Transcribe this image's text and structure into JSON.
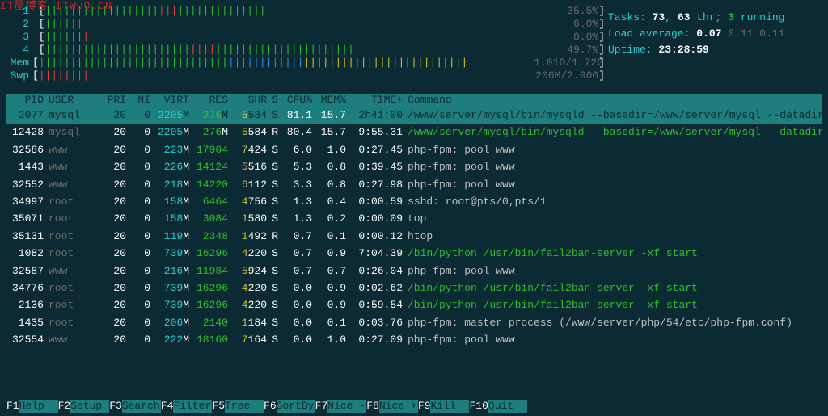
{
  "watermark": "IT屋博客  ITWUO.CN",
  "cpumeters": [
    {
      "label": "1",
      "seg": [
        {
          "c": "g",
          "n": 18
        },
        {
          "c": "r",
          "n": 3
        },
        {
          "c": "g",
          "n": 14
        }
      ],
      "pct": "35.5%"
    },
    {
      "label": "2",
      "seg": [
        {
          "c": "g",
          "n": 5
        },
        {
          "c": "r",
          "n": 1
        }
      ],
      "pct": "6.0%"
    },
    {
      "label": "3",
      "seg": [
        {
          "c": "g",
          "n": 6
        },
        {
          "c": "r",
          "n": 1
        }
      ],
      "pct": "8.0%"
    },
    {
      "label": "4",
      "seg": [
        {
          "c": "g",
          "n": 23
        },
        {
          "c": "r",
          "n": 4
        },
        {
          "c": "g",
          "n": 22
        }
      ],
      "pct": "49.7%"
    }
  ],
  "mem": {
    "label": "Mem",
    "seg": [
      {
        "c": "g",
        "n": 30
      },
      {
        "c": "bl",
        "n": 12
      },
      {
        "c": "y",
        "n": 26
      }
    ],
    "pct": "1.01G/1.72G"
  },
  "swp": {
    "label": "Swp",
    "seg": [
      {
        "c": "r",
        "n": 8
      }
    ],
    "pct": "206M/2.00G"
  },
  "info": {
    "tasks_label": "Tasks: ",
    "tasks": "73",
    "tasks_sep": ", ",
    "thr": "63",
    "thr_lbl": " thr; ",
    "running": "3",
    "running_lbl": " running",
    "la_label": "Load average: ",
    "la1": "0.07",
    "la2": " 0.11",
    "la3": " 0.11",
    "uptime_label": "Uptime: ",
    "uptime": "23:28:59"
  },
  "header": {
    "pid": "PID",
    "user": "USER",
    "pri": "PRI",
    "ni": "NI",
    "virt": "VIRT",
    "res": "RES",
    "shr": "SHR",
    "s": "S",
    "cpu": "CPU%",
    "mem": "MEM%",
    "time": "TIME+",
    "cmd": "Command"
  },
  "rows": [
    {
      "sel": true,
      "pid": "2077",
      "user": "mysql",
      "pri": "20",
      "ni": "0",
      "virt": "2205M",
      "res": "276M",
      "shr": "5584",
      "s": "S",
      "cpu": "81.1",
      "mem": "15.7",
      "time": "2h41:00",
      "cmd": "/www/server/mysql/bin/mysqld --basedir=/www/server/mysql --datadir"
    },
    {
      "pid": "12428",
      "user": "mysql",
      "pri": "20",
      "ni": "0",
      "virt": "2205M",
      "res": "276M",
      "shr": "5584",
      "s": "R",
      "cpu": "80.4",
      "mem": "15.7",
      "time": "9:55.31",
      "cmd": "/www/server/mysql/bin/mysqld --basedir=/www/server/mysql --datadir",
      "green": true
    },
    {
      "pid": "32586",
      "user": "www",
      "pri": "20",
      "ni": "0",
      "virt": "223M",
      "res": "17904",
      "shr": "7424",
      "s": "S",
      "cpu": "6.0",
      "mem": "1.0",
      "time": "0:27.45",
      "cmd": "php-fpm: pool www"
    },
    {
      "pid": "1443",
      "user": "www",
      "pri": "20",
      "ni": "0",
      "virt": "226M",
      "res": "14124",
      "shr": "5516",
      "s": "S",
      "cpu": "5.3",
      "mem": "0.8",
      "time": "0:39.45",
      "cmd": "php-fpm: pool www"
    },
    {
      "pid": "32552",
      "user": "www",
      "pri": "20",
      "ni": "0",
      "virt": "218M",
      "res": "14220",
      "shr": "6112",
      "s": "S",
      "cpu": "3.3",
      "mem": "0.8",
      "time": "0:27.98",
      "cmd": "php-fpm: pool www"
    },
    {
      "pid": "34997",
      "user": "root",
      "pri": "20",
      "ni": "0",
      "virt": "158M",
      "res": "6464",
      "shr": "4756",
      "s": "S",
      "cpu": "1.3",
      "mem": "0.4",
      "time": "0:00.59",
      "cmd": "sshd: root@pts/0,pts/1"
    },
    {
      "pid": "35071",
      "user": "root",
      "pri": "20",
      "ni": "0",
      "virt": "158M",
      "res": "3084",
      "shr": "1580",
      "s": "S",
      "cpu": "1.3",
      "mem": "0.2",
      "time": "0:00.09",
      "cmd": "top"
    },
    {
      "pid": "35131",
      "user": "root",
      "pri": "20",
      "ni": "0",
      "virt": "119M",
      "res": "2348",
      "shr": "1492",
      "s": "R",
      "cpu": "0.7",
      "mem": "0.1",
      "time": "0:00.12",
      "cmd": "htop"
    },
    {
      "pid": "1082",
      "user": "root",
      "pri": "20",
      "ni": "0",
      "virt": "739M",
      "res": "16296",
      "shr": "4220",
      "s": "S",
      "cpu": "0.7",
      "mem": "0.9",
      "time": "7:04.39",
      "cmd": "/bin/python /usr/bin/fail2ban-server -xf start",
      "green": true
    },
    {
      "pid": "32587",
      "user": "www",
      "pri": "20",
      "ni": "0",
      "virt": "216M",
      "res": "11984",
      "shr": "5924",
      "s": "S",
      "cpu": "0.7",
      "mem": "0.7",
      "time": "0:26.04",
      "cmd": "php-fpm: pool www"
    },
    {
      "pid": "34776",
      "user": "root",
      "pri": "20",
      "ni": "0",
      "virt": "739M",
      "res": "16296",
      "shr": "4220",
      "s": "S",
      "cpu": "0.0",
      "mem": "0.9",
      "time": "0:02.62",
      "cmd": "/bin/python /usr/bin/fail2ban-server -xf start",
      "green": true
    },
    {
      "pid": "2136",
      "user": "root",
      "pri": "20",
      "ni": "0",
      "virt": "739M",
      "res": "16296",
      "shr": "4220",
      "s": "S",
      "cpu": "0.0",
      "mem": "0.9",
      "time": "0:59.54",
      "cmd": "/bin/python /usr/bin/fail2ban-server -xf start",
      "green": true
    },
    {
      "pid": "1435",
      "user": "root",
      "pri": "20",
      "ni": "0",
      "virt": "206M",
      "res": "2140",
      "shr": "1184",
      "s": "S",
      "cpu": "0.0",
      "mem": "0.1",
      "time": "0:03.76",
      "cmd": "php-fpm: master process (/www/server/php/54/etc/php-fpm.conf)"
    },
    {
      "pid": "32554",
      "user": "www",
      "pri": "20",
      "ni": "0",
      "virt": "222M",
      "res": "18160",
      "shr": "7164",
      "s": "S",
      "cpu": "0.0",
      "mem": "1.0",
      "time": "0:27.09",
      "cmd": "php-fpm: pool www"
    }
  ],
  "fkeys": [
    {
      "k": "F1",
      "l": "Help "
    },
    {
      "k": "F2",
      "l": "Setup "
    },
    {
      "k": "F3",
      "l": "Search"
    },
    {
      "k": "F4",
      "l": "Filter"
    },
    {
      "k": "F5",
      "l": "Tree  "
    },
    {
      "k": "F6",
      "l": "SortBy"
    },
    {
      "k": "F7",
      "l": "Nice -"
    },
    {
      "k": "F8",
      "l": "Nice +"
    },
    {
      "k": "F9",
      "l": "Kill  "
    },
    {
      "k": "F10",
      "l": "Quit  "
    }
  ]
}
